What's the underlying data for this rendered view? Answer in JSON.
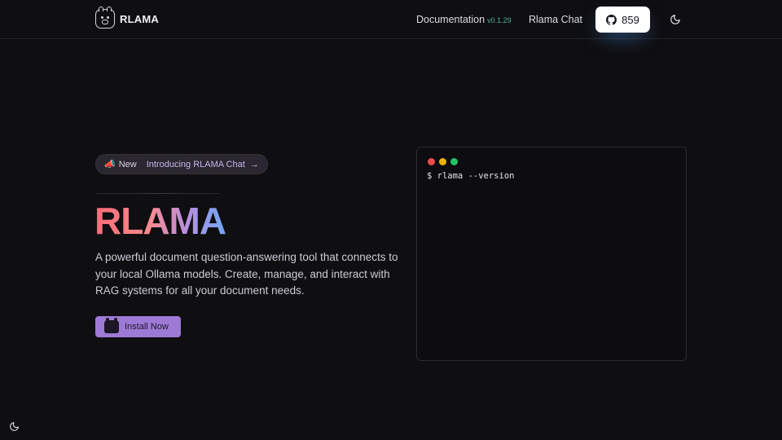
{
  "header": {
    "brand_name": "RLAMA",
    "nav": {
      "documentation_label": "Documentation",
      "version": "v0.1.29",
      "chat_label": "Rlama Chat"
    },
    "github": {
      "stars": "859",
      "icon": "github-icon"
    },
    "theme_icon": "moon-icon"
  },
  "hero": {
    "badge": {
      "icon": "megaphone-icon",
      "new_label": "New",
      "intro_label": "Introducing RLAMA Chat",
      "arrow": "→"
    },
    "title": "RLAMA",
    "description": "A powerful document question-answering tool that connects to your local Ollama models. Create, manage, and interact with RAG systems for all your document needs.",
    "install_button": {
      "label": "Install Now",
      "icon": "llama-icon"
    }
  },
  "terminal": {
    "command": "$ rlama --version"
  },
  "footer": {
    "theme_icon": "moon-icon"
  },
  "colors": {
    "background": "#0f0e11",
    "accent_purple": "#9d7ad6",
    "version_green": "#4fb39a",
    "title_gradient": [
      "#ff6b7a",
      "#b98fe0",
      "#6ea8f5"
    ]
  }
}
